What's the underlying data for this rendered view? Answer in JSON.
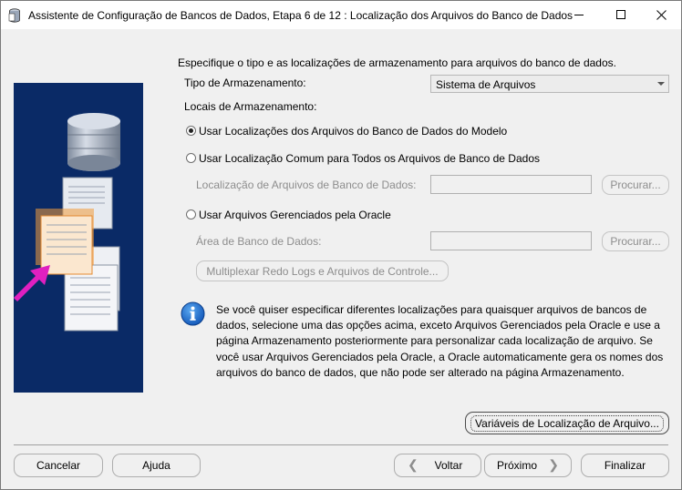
{
  "window": {
    "title": "Assistente de Configuração de Bancos de Dados, Etapa 6 de 12 : Localização dos Arquivos do Banco de Dados",
    "controls": {
      "minimize": "minimize-icon",
      "maximize": "maximize-icon",
      "close": "close-icon"
    }
  },
  "main": {
    "intro": "Especifique o tipo e as localizações de armazenamento para arquivos do banco de dados.",
    "storage_type_label": "Tipo de Armazenamento:",
    "storage_type_value": "Sistema de Arquivos",
    "locations_label": "Locais de Armazenamento:",
    "option_template": "Usar Localizações dos Arquivos do Banco de Dados do Modelo",
    "option_common": "Usar Localização Comum para Todos os Arquivos de Banco de Dados",
    "common_location_label": "Localização de Arquivos de Banco de Dados:",
    "common_location_value": "",
    "browse_1": "Procurar...",
    "option_omf": "Usar Arquivos Gerenciados pela Oracle",
    "db_area_label": "Área de Banco de Dados:",
    "db_area_value": "",
    "browse_2": "Procurar...",
    "multiplex_button": "Multiplexar Redo Logs e Arquivos de Controle...",
    "info_text": "Se você quiser especificar diferentes localizações para quaisquer arquivos de bancos de dados, selecione uma das opções acima, exceto Arquivos Gerenciados pela Oracle e use a página Armazenamento posteriormente para personalizar cada localização de arquivo. Se você usar Arquivos Gerenciados pela Oracle, a Oracle automaticamente gera os nomes dos arquivos do banco de dados, que não pode ser alterado na página Armazenamento.",
    "location_vars_button": "Variáveis de Localização de Arquivo..."
  },
  "footer": {
    "cancel": "Cancelar",
    "help": "Ajuda",
    "back": "Voltar",
    "next": "Próximo",
    "finish": "Finalizar"
  },
  "selected_option": "option_template",
  "colors": {
    "art_background": "#0a2a66",
    "arrow": "#e020c0",
    "highlight_doc": "#f39a3a"
  }
}
